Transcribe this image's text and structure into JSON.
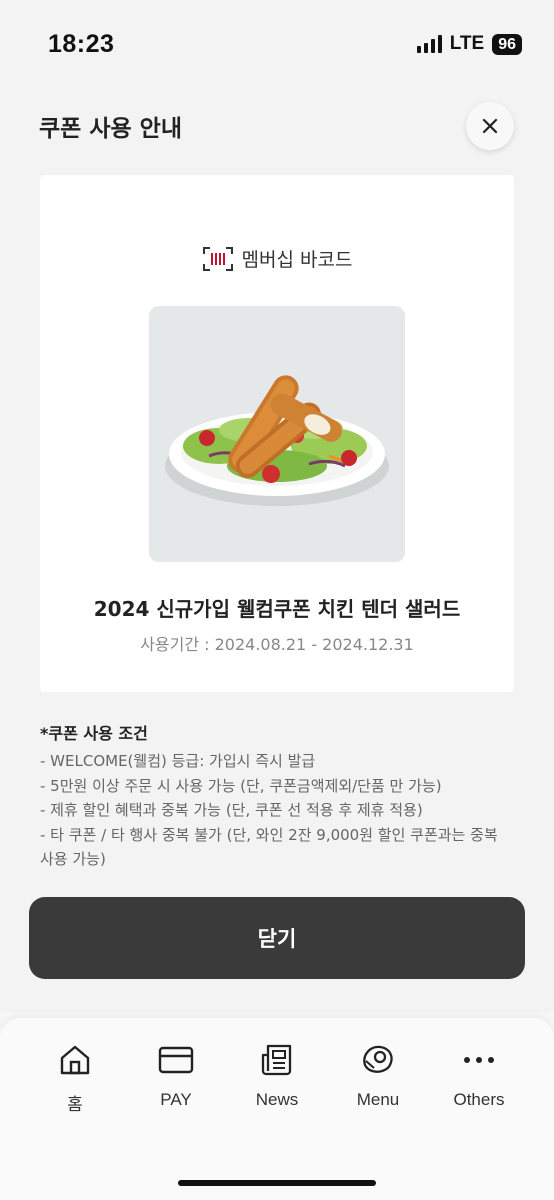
{
  "status_bar": {
    "time": "18:23",
    "network": "LTE",
    "battery": "96"
  },
  "sheet": {
    "title": "쿠폰 사용 안내",
    "close_icon": "close-icon"
  },
  "coupon": {
    "barcode_label": "멤버십 바코드",
    "barcode_icon": "barcode-icon",
    "image": "chicken-tender-salad",
    "name": "2024 신규가입 웰컴쿠폰 치킨 텐더 샐러드",
    "period": "사용기간 : 2024.08.21 - 2024.12.31"
  },
  "conditions": {
    "title": "*쿠폰 사용 조건",
    "items": [
      "- WELCOME(웰컴) 등급: 가입시 즉시 발급",
      "- 5만원 이상 주문 시 사용 가능 (단, 쿠폰금액제외/단품 만 가능)",
      "- 제휴 할인 혜택과 중복 가능 (단, 쿠폰 선 적용 후 제휴 적용)",
      "- 타 쿠폰 / 타 행사 중복 불가 (단, 와인 2잔 9,000원 할인 쿠폰과는 중복 사용 가능)"
    ]
  },
  "close_button": {
    "label": "닫기"
  },
  "nav": {
    "items": [
      {
        "label": "홈",
        "icon": "home-icon"
      },
      {
        "label": "PAY",
        "icon": "card-icon"
      },
      {
        "label": "News",
        "icon": "news-icon"
      },
      {
        "label": "Menu",
        "icon": "steak-icon"
      },
      {
        "label": "Others",
        "icon": "more-icon"
      }
    ]
  },
  "colors": {
    "accent": "#c8102e",
    "button": "#3a3a3a"
  }
}
